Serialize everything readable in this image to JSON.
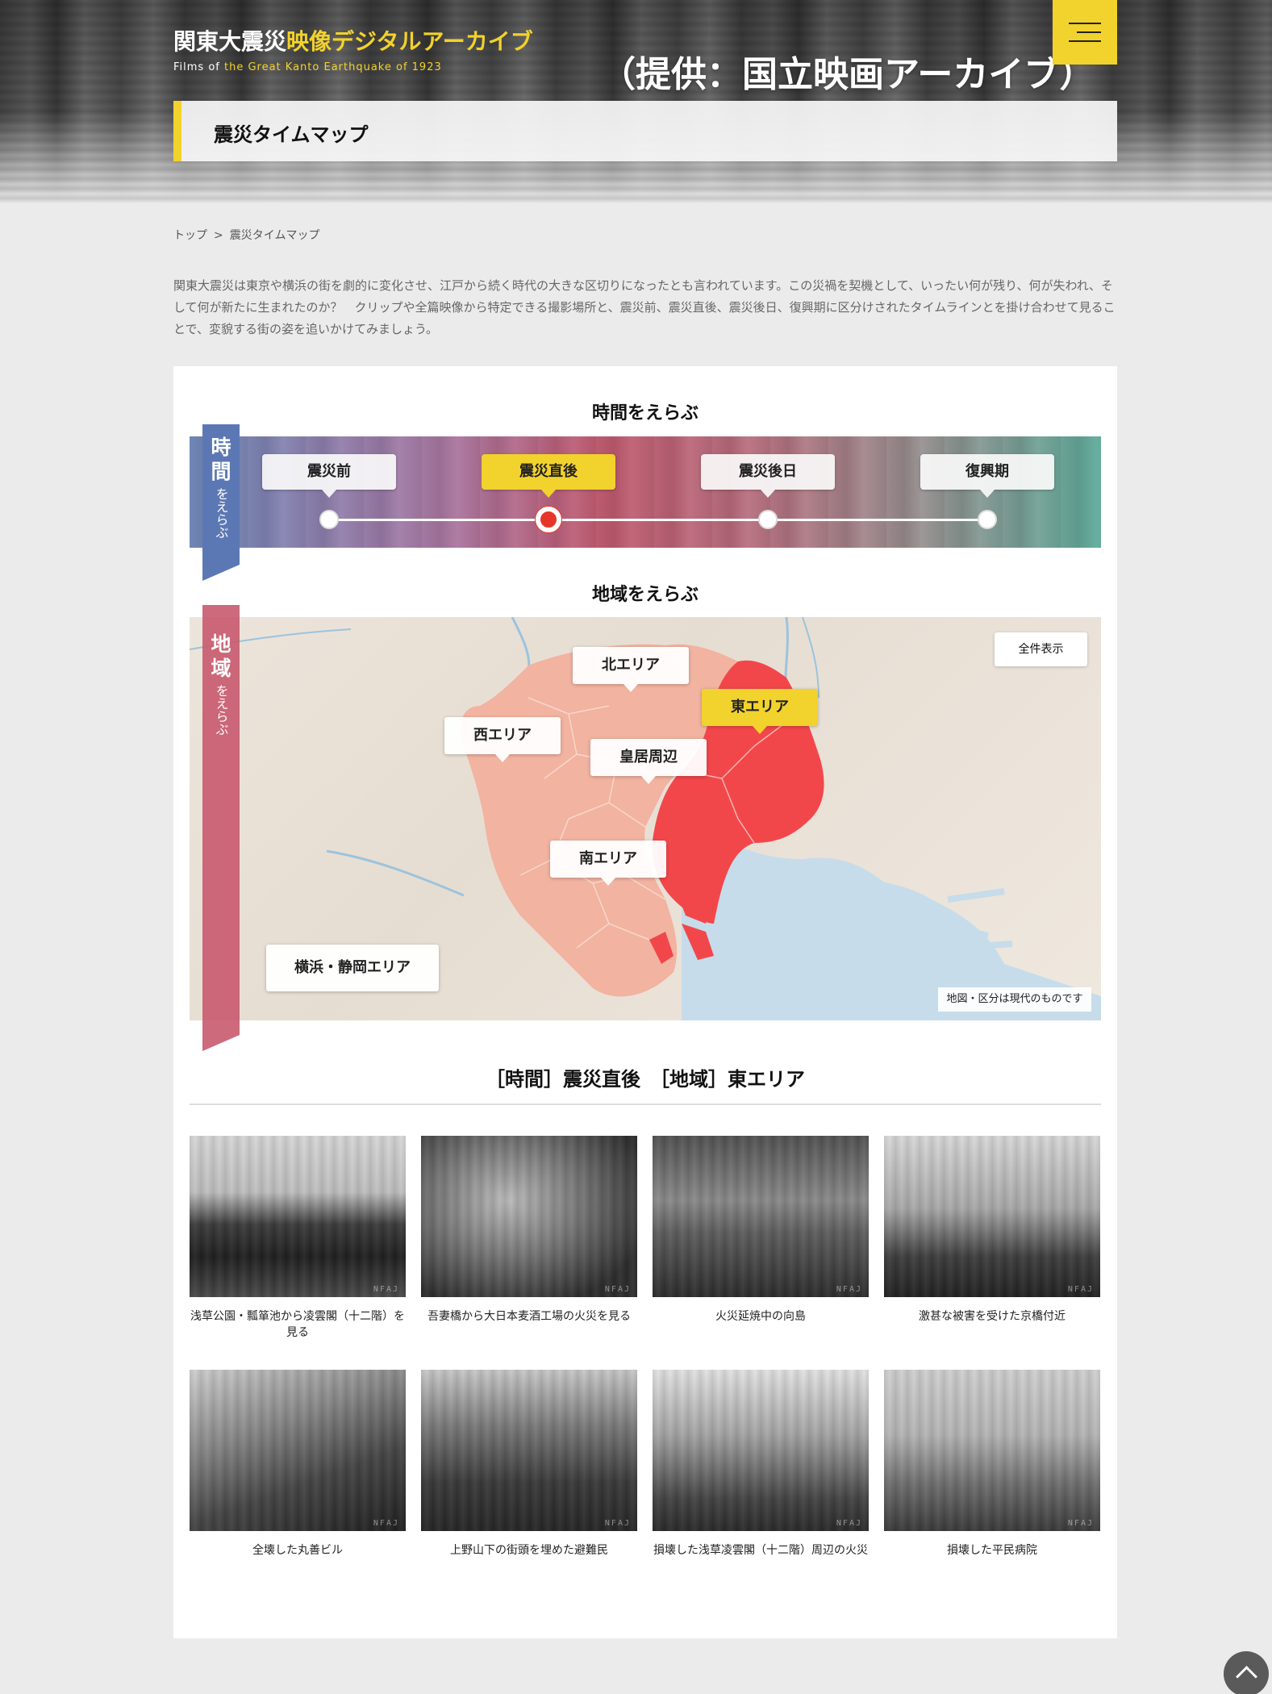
{
  "header": {
    "brand_title_a": "関東大震災",
    "brand_title_b": "映像デジタルアーカイブ",
    "brand_sub_a": "Films of ",
    "brand_sub_b": "the Great Kanto Earthquake of 1923",
    "credit": "（提供：国立映画アーカイブ）",
    "menu_icon": "hamburger-menu-icon",
    "page_title": "震災タイムマップ"
  },
  "breadcrumb": {
    "home": "トップ",
    "separator": ">",
    "current": "震災タイムマップ"
  },
  "intro": "関東大震災は東京や横浜の街を劇的に変化させ、江戸から続く時代の大きな区切りになったとも言われています。この災禍を契機として、いったい何が残り、何が失われ、そして何が新たに生まれたのか？　クリップや全篇映像から特定できる撮影場所と、震災前、震災直後、震災後日、復興期に区分けされたタイムラインとを掛け合わせて見ることで、変貌する街の姿を追いかけてみましょう。",
  "time_section": {
    "heading": "時間をえらぶ",
    "ribbon_kanji_1": "時",
    "ribbon_kanji_2": "間",
    "ribbon_kana": "をえらぶ",
    "stops": [
      {
        "label": "震災前",
        "active": false
      },
      {
        "label": "震災直後",
        "active": true
      },
      {
        "label": "震災後日",
        "active": false
      },
      {
        "label": "復興期",
        "active": false
      }
    ]
  },
  "area_section": {
    "heading": "地域をえらぶ",
    "ribbon_kanji_1": "地",
    "ribbon_kanji_2": "域",
    "ribbon_kana": "をえらぶ",
    "show_all": "全件表示",
    "areas": {
      "north": "北エリア",
      "east": "東エリア",
      "west": "西エリア",
      "palace": "皇居周辺",
      "south": "南エリア",
      "yokohama": "横浜・静岡エリア"
    },
    "active_area": "東エリア",
    "note": "地図・区分は現代のものです",
    "colors": {
      "active_area": "#f2474a",
      "areas": "#f2b3a0",
      "water": "#c6dcea",
      "land": "#e9e1d6"
    }
  },
  "results": {
    "heading": "［時間］震災直後　［地域］東エリア",
    "watermark": "NFAJ",
    "items": [
      {
        "caption": "浅草公園・瓢箪池から凌雲閣（十二階）を見る"
      },
      {
        "caption": "吾妻橋から大日本麦酒工場の火災を見る"
      },
      {
        "caption": "火災延焼中の向島"
      },
      {
        "caption": "激甚な被害を受けた京橋付近"
      },
      {
        "caption": "全壊した丸善ビル"
      },
      {
        "caption": "上野山下の街頭を埋めた避難民"
      },
      {
        "caption": "損壊した浅草凌雲閣（十二階）周辺の火災"
      },
      {
        "caption": "損壊した平民病院"
      }
    ]
  },
  "back_to_top_icon": "chevron-up-icon",
  "accent_color": "#f2d22c"
}
